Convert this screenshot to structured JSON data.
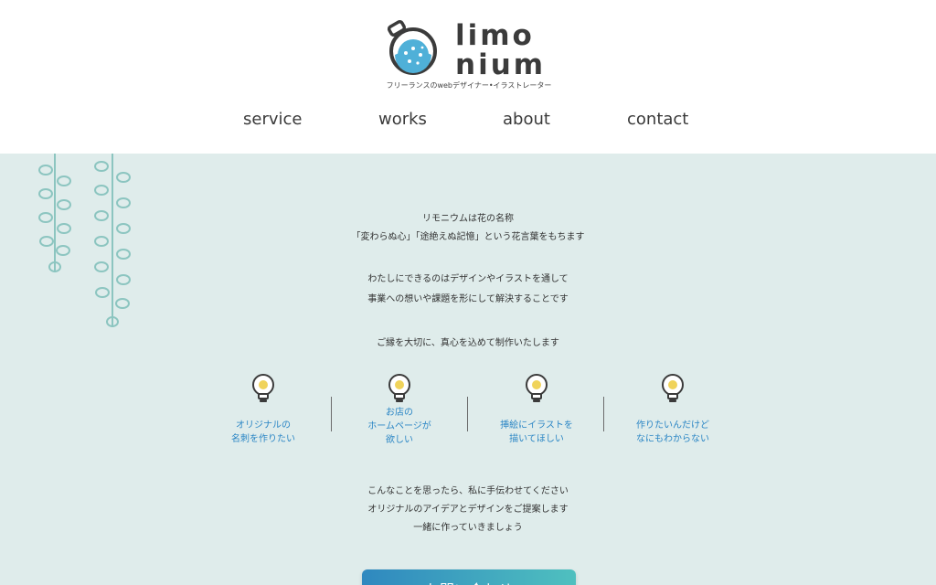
{
  "brand": {
    "line1": "limo",
    "line2": "nium",
    "tagline": "フリーランスのwebデザイナー•イラストレーター"
  },
  "nav": {
    "items": [
      "service",
      "works",
      "about",
      "contact"
    ]
  },
  "intro": {
    "lines": [
      "リモニウムは花の名称",
      "「変わらぬ心」「途絶えぬ記憶」という花言葉をもちます",
      "わたしにできるのはデザインやイラストを通して",
      "事業への想いや課題を形にして解決することです",
      "ご縁を大切に、真心を込めて制作いたします"
    ]
  },
  "features": [
    {
      "icon": "lightbulb-icon",
      "lines": [
        "オリジナルの",
        "名刺を作りたい"
      ]
    },
    {
      "icon": "lightbulb-icon",
      "lines": [
        "お店の",
        "ホームページが",
        "欲しい"
      ]
    },
    {
      "icon": "lightbulb-icon",
      "lines": [
        "挿絵にイラストを",
        "描いてほしい"
      ]
    },
    {
      "icon": "lightbulb-icon",
      "lines": [
        "作りたいんだけど",
        "なにもわからない"
      ]
    }
  ],
  "outro": {
    "lines": [
      "こんなことを思ったら、私に手伝わせてください",
      "オリジナルのアイデアとデザインをご提案します",
      "一緒に作っていきましょう"
    ]
  },
  "cta": {
    "label": "お問い合わせ"
  },
  "colors": {
    "background": "#dfeceb",
    "accent_blue": "#2b86c5",
    "cta_gradient_start": "#2f88bf",
    "cta_gradient_end": "#4fc0bf",
    "vine": "#8cc5c0"
  }
}
